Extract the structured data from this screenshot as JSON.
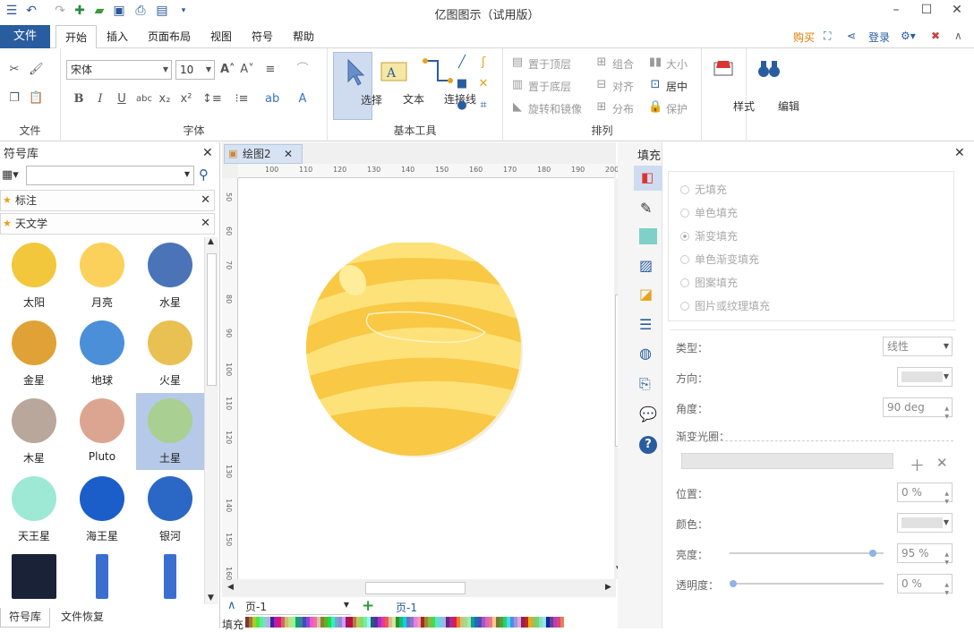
{
  "app": {
    "title": "亿图图示（试用版）"
  },
  "ribbon_tabs": [
    "文件",
    "开始",
    "插入",
    "页面布局",
    "视图",
    "符号",
    "帮助"
  ],
  "ribbon_links": {
    "buy": "购买",
    "login": "登录"
  },
  "font": {
    "name": "宋体",
    "size": "10"
  },
  "groups": {
    "file": "文件",
    "font": "字体",
    "tools": "基本工具",
    "arrange": "排列"
  },
  "tools": {
    "select": "选择",
    "text": "文本",
    "connector": "连接线"
  },
  "arrange": {
    "bring_top": "置于顶层",
    "send_bottom": "置于底层",
    "rotate": "旋转和镜像",
    "group": "组合",
    "align": "对齐",
    "distribute": "分布",
    "size": "大小",
    "center": "居中",
    "protect": "保护"
  },
  "style_label": "样式",
  "edit_label": "编辑",
  "library": {
    "title": "符号库",
    "search_placeholder": "",
    "categories": [
      "标注",
      "天文学"
    ],
    "symbols": [
      {
        "name": "太阳",
        "color": "#f2c73c"
      },
      {
        "name": "月亮",
        "color": "#fcd15b"
      },
      {
        "name": "水星",
        "color": "#4b74b8"
      },
      {
        "name": "金星",
        "color": "#e0a236"
      },
      {
        "name": "地球",
        "color": "#4a8fd8"
      },
      {
        "name": "火星",
        "color": "#e9c152"
      },
      {
        "name": "木星",
        "color": "#b8a79a"
      },
      {
        "name": "Pluto",
        "color": "#dca591"
      },
      {
        "name": "土星",
        "color": "#a9cf93"
      },
      {
        "name": "天王星",
        "color": "#9ee8d6"
      },
      {
        "name": "海王星",
        "color": "#1b5ec9"
      },
      {
        "name": "银河",
        "color": "#2b67c4"
      },
      {
        "name": "",
        "color": "#1a2238"
      },
      {
        "name": "",
        "color": "#ffffff"
      },
      {
        "name": "",
        "color": "#ffffff"
      }
    ],
    "bottom_tabs": [
      "符号库",
      "文件恢复"
    ]
  },
  "document": {
    "tab": "绘图2",
    "ruler_h": [
      "100",
      "110",
      "120",
      "130",
      "140",
      "150",
      "160",
      "170",
      "180",
      "190",
      "200"
    ],
    "ruler_v": [
      "50",
      "60",
      "70",
      "80",
      "90",
      "100",
      "110",
      "120",
      "130",
      "140",
      "150",
      "160"
    ],
    "page_select": "页-1",
    "page_tab": "页-1",
    "fill_label": "填充"
  },
  "fill_panel": {
    "title": "填充",
    "options": [
      "无填充",
      "单色填充",
      "渐变填充",
      "单色渐变填充",
      "图案填充",
      "图片或纹理填充"
    ],
    "type_label": "类型：",
    "type_value": "线性",
    "direction_label": "方向：",
    "angle_label": "角度：",
    "angle_value": "90 deg",
    "gradient_label": "渐变光圈：",
    "position_label": "位置：",
    "position_value": "0 %",
    "color_label": "颜色：",
    "brightness_label": "亮度：",
    "brightness_value": "95 %",
    "transparency_label": "透明度：",
    "transparency_value": "0 %"
  },
  "colors": {
    "accent": "#2a5d9f",
    "planet": "#fde27a",
    "planet_stripe": "#f9c845"
  }
}
